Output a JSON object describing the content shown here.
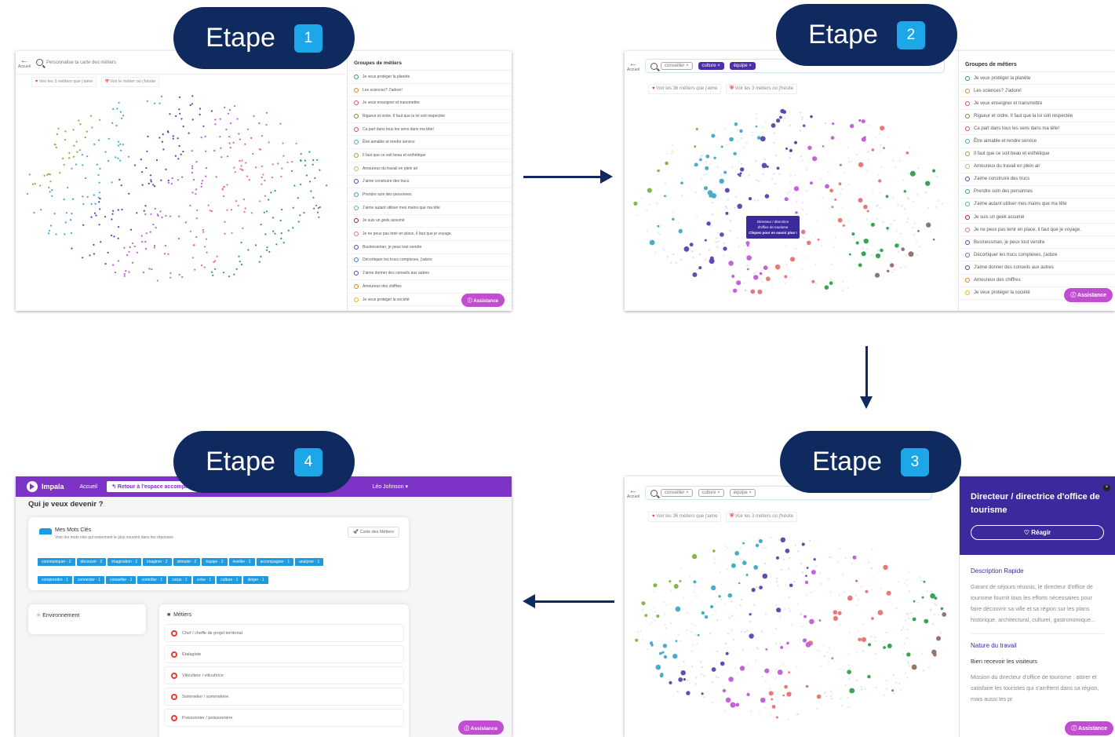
{
  "steps": [
    {
      "label": "Etape",
      "num": "1"
    },
    {
      "label": "Etape",
      "num": "2"
    },
    {
      "label": "Etape",
      "num": "3"
    },
    {
      "label": "Etape",
      "num": "4"
    }
  ],
  "common": {
    "back_label": "Accueil",
    "assist_label": "Assistance",
    "groups_title": "Groupes de métiers"
  },
  "s1": {
    "search_placeholder": "Personnalise ta carte des métiers",
    "btn_like": "Voir les 3 métiers que j'aime",
    "btn_hesitate": "Voir le métier où j'hésite",
    "groups": [
      "Je veux protéger la planète",
      "Les sciences? J'adore!",
      "Je veux enseigner et transmettre",
      "Rigueur et ordre. Il faut que la loi soit respectée",
      "Ca part dans tous les sens dans ma tête!",
      "Être aimable et rendre service",
      "Il faut que ce soit beau et esthétique",
      "Amoureux du travail en plein air",
      "J'aime construire des trucs",
      "Prendre soin des personnes",
      "J'aime autant utiliser mes mains que ma tête",
      "Je suis un geek assumé",
      "Je ne peux pas tenir en place, il faut que je voyage.",
      "Businessman, je peux tout vendre",
      "Décortiquer les trucs complexes, j'adore",
      "J'aime donner des conseils aux autres",
      "Amoureux des chiffres",
      "Je veux protéger la société"
    ]
  },
  "s2": {
    "tags": [
      "conseiller",
      "culture",
      "équipe"
    ],
    "btn_like": "Voir les 36 métiers que j'aime",
    "btn_hesitate": "Voir les 3 métiers où j'hésite",
    "tooltip_line1": "Directeur / directrice",
    "tooltip_line2": "d'office de tourisme",
    "tooltip_line3": "Cliquez pour en savoir plus !",
    "groups": [
      "Je veux protéger la planète",
      "Les sciences? J'adore!",
      "Je veux enseigner et transmettre",
      "Rigueur et ordre. Il faut que la loi soit respectée",
      "Ca part dans tous les sens dans ma tête!",
      "Être aimable et rendre service",
      "Il faut que ce soit beau et esthétique",
      "Amoureux du travail en plein air",
      "J'aime construire des trucs",
      "Prendre soin des personnes",
      "J'aime autant utiliser mes mains que ma tête",
      "Je suis un geek assumé",
      "Je ne peux pas tenir en place, il faut que je voyage.",
      "Businessman, je peux tout vendre",
      "Décortiquer les trucs complexes, j'adore",
      "J'aime donner des conseils aux autres",
      "Amoureux des chiffres",
      "Je veux protéger la société"
    ]
  },
  "s3": {
    "tags": [
      "conseiller",
      "culture",
      "équipe"
    ],
    "btn_like": "Voir les 36 métiers que j'aime",
    "btn_hesitate": "Voir les 3 métiers où j'hésite",
    "detail_title": "Directeur / directrice d'office de tourisme",
    "react_label": "Réagir",
    "desc_title": "Description Rapide",
    "desc_text": "Garant de séjours réussis, le directeur d'office de tourisme fournit tous les efforts nécessaires pour faire découvrir sa ville et sa région sur les plans historique, architectural, culturel, gastronomique...",
    "nature_title": "Nature du travail",
    "visit_title": "Bien recevoir les visiteurs",
    "visit_text": "Mission du directeur d'office de tourisme : attirer et satisfaire les touristes qui s'arrêtent dans sa région, mais aussi les pr"
  },
  "s4": {
    "logo": "Impala",
    "nav_home": "Accueil",
    "nav_return": "Retour à l'espace accompagnant",
    "user": "Léo Johnson",
    "page_title": "Qui je veux devenir ?",
    "keywords_title": "Mes Mots Clés",
    "keywords_sub": "Voici les mots clés qui reviennent le plus souvent dans tes réponses",
    "map_btn": "Carte des Métiers",
    "keywords": [
      "communiquer · 2",
      "découvrir · 2",
      "imagination · 2",
      "imaginer · 2",
      "stimuler · 2",
      "équipe · 2",
      "éveiller · 2",
      "accompagner · 1",
      "analyser · 1",
      "comprendre · 1",
      "connecter · 1",
      "conseiller · 1",
      "contrôler · 1",
      "corps · 1",
      "créer · 1",
      "culture · 1",
      "diriger · 1"
    ],
    "env_title": "Environnement",
    "jobs_title": "Métiers",
    "jobs": [
      "Chef / cheffe de projet territorial",
      "Étalagiste",
      "Viticulteur / viticultrice",
      "Sommelier / sommelière",
      "Poissonnier / poissonnière"
    ]
  }
}
